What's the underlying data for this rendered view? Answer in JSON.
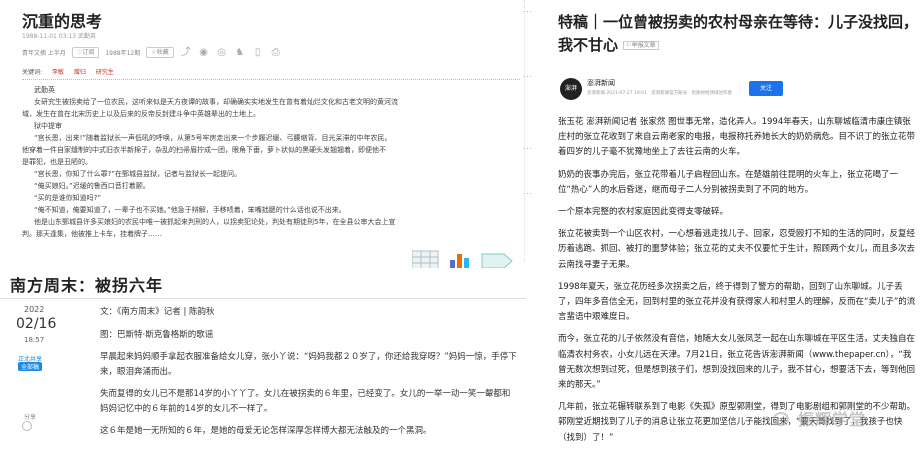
{
  "panel1": {
    "title": "沉重的思考",
    "meta": "1988-11-01 03:13 武勤英",
    "toolbar": [
      "青年文摘 上半月",
      "订阅",
      "1988年12期",
      "收藏"
    ],
    "keywords_label": "关键词:",
    "keywords": [
      "李敏",
      "赠归",
      "研究生"
    ],
    "body": [
      "武勤英",
      "女研究生被拐卖给了一位农民，这听来似是天方夜谭的故事，却确确实实地发生在曾有着灿烂文化和古老文明的黄河流",
      "域，发生在曾在北宋历史上以及后来的反帝反封建斗争中英雄辈出的土地上。",
      "狱中提审",
      "“宫长恩，出来!”随着监狱长一声低吼的呼唤，从第5号牢房走出来一个步履迟缓、弓腰缩背、目光呆滞的中年农民。",
      "他穿着一件自家缝制的中式旧衣半新棉子，杂乱的扫帚眉拧成一团，眼角下垂，萝卜状似的黑硬头发翘翘着，即便他不",
      "是罪犯，也是丑陋的。",
      "“宫长恩，你知了什么罪?”在鄄城县监狱，记者与监狱长一起提问。",
      "“俺买娘妇。”迟缓的鲁西口音打着颤。",
      "“买的是谁你知道吗?”",
      "“俺不知道，俺要知道了，一辈子也不买她。”他急于辩解，手移啧着，笨嘴拙腮的什么话也说不出来。",
      "他是山东鄄城县许多买娘妇的农民中唯一被抓起来判刑的人，以拐卖犯论处，判处有期徒刑5年，在全县公审大会上宣",
      "判。那天逢集，他被推上卡车，挂着牌子……"
    ]
  },
  "panel2": {
    "title": "南方周末：被拐六年",
    "date_year": "2022",
    "date_md": "02/16",
    "date_time": "18:57",
    "tag_blue": "正北共享",
    "tag_badge": "全部稿",
    "share_label": "分享",
    "body": [
      "文：《南方周末》记者 | 陈韵秋",
      "图：巴斯特·斯克鲁格斯的歌谣",
      "早晨起来妈妈顺手拿起衣服准备给女儿穿，张小丫说：“妈妈我都２０岁了，你还给我穿呀？”妈妈一惊，手停下来，眼泪奔涌而出。",
      "失而复得的女儿已不是那14岁的小丫丫了。女儿在被拐卖的６年里，已经变了。女儿的一举一动一笑一颦都和妈妈记忆中的６年前的14岁的女儿不一样了。",
      "这６年是她一无所知的６年，是她的母爱无论怎样深厚怎样博大都无法触及的一个黑洞。"
    ]
  },
  "panel3": {
    "title": "特稿｜一位曾被拐卖的农村母亲在等待：儿子没找回，我不甘心",
    "report_link": "举报文章",
    "source_logo": "澎湃",
    "source_name": "澎湃新闻",
    "source_meta": "澎湃新闻 2021-07-27 19:01 · 澎湃新闻官方账号 · 优质财经领域创作者",
    "follow_label": "关注",
    "body": [
      "张玉花 澎湃新闻记者 张家然 图世事无常，造化弄人。1994年春天，山东聊城临清市康庄镇张庄村的张立花收到了来自云南老家的电报，电报称托养她长大的奶奶病危。目不识丁的张立花带着四岁的儿子毫不犹豫地坐上了去往云南的火车。",
      "奶奶的丧事办完后，张立花带着儿子启程回山东。在楚雄前往昆明的火车上，张立花喝了一位“热心”人的水后昏迷，继而母子二人分别被拐卖到了不同的地方。",
      "一个原本完整的农村家庭因此变得支零破碎。",
      "张立花被卖到一个山区农村，一心想着逃走找儿子、回家，忍受殴打不知的生活的同时，反复经历着逃跑、抓回、被打的噩梦体验；张立花的丈夫不仅要忙于生计，照顾两个女儿，而且多次去云南找寻妻子无果。",
      "1998年夏天，张立花历经多次拐卖之后，终于得到了警方的帮助，回到了山东聊城。儿子丢了，四年多音信全无，回到村里的张立花并没有获得家人和村里人的理解，反而在“卖儿子”的流言蜚语中艰难度日。",
      "而今，张立花的儿子依然没有音信，她随大女儿张凤芝一起在山东聊城在平区生活，丈夫独自在临清农村务农，小女儿远在天津。7月21日，张立花告诉澎湃新闻（www.thepaper.cn），“我曾无数次想到过死，但是想到孩子们，想到没找回来的儿子，我不甘心，想要活下去，等到他回来的那天。”",
      "几年前，张立花辗转联系到了电影《失孤》原型郭刚堂，得到了电影剧组和郭刚堂的不少帮助。郭刚堂近期找到了儿子的消息让张立花更加坚信儿子能找回来，“要天哥找到了，我孩子也快（找到）了！”"
    ],
    "watermark": "振辉学堂"
  }
}
